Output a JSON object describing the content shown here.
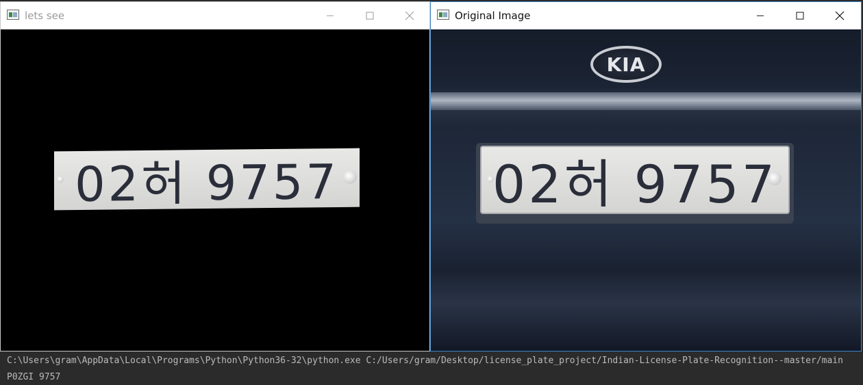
{
  "left_window": {
    "title": "lets see",
    "plate_text": "02허 9757"
  },
  "right_window": {
    "title": "Original Image",
    "logo_text": "KIA",
    "plate_text": "02허 9757"
  },
  "console": {
    "lines": [
      "C:\\Users\\gram\\AppData\\Local\\Programs\\Python\\Python36-32\\python.exe C:/Users/gram/Desktop/license_plate_project/Indian-License-Plate-Recognition--master/main",
      "P0ZGI 9757"
    ]
  },
  "icons": {
    "app": "opencv-window-icon",
    "minimize": "minimize-icon",
    "maximize": "maximize-icon",
    "close": "close-icon"
  },
  "colors": {
    "console_bg": "#2b2b2b",
    "active_border": "#3a86c8"
  }
}
